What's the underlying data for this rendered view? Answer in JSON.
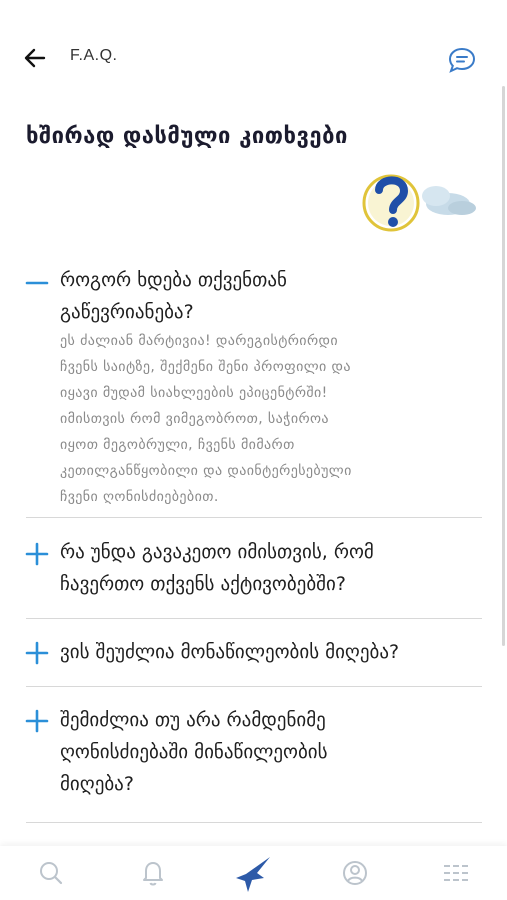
{
  "header": {
    "title": "F.A.Q.",
    "back_icon": "arrow-left-icon",
    "chat_icon": "chat-bubble-icon"
  },
  "page": {
    "title": "ხშირად დასმული კითხვები"
  },
  "faq": [
    {
      "question_lines": [
        "როგორ ხდება თქვენთან",
        "გაწევრიანება?"
      ],
      "expanded": true,
      "answer_lines": [
        "ეს ძალიან მარტივია! დარეგისტრირდი",
        "ჩვენს საიტზე, შექმენი შენი პროფილი და",
        "იყავი მუდამ სიახლეების ეპიცენტრში!",
        "იმისთვის რომ ვიმეგობროთ, საჭიროა",
        "იყოთ მეგობრული, ჩვენს მიმართ",
        "კეთილგანწყობილი და დაინტერესებული",
        "ჩვენი ღონისძიებებით."
      ]
    },
    {
      "question_lines": [
        "რა უნდა გავაკეთო იმისთვის, რომ",
        "ჩავერთო თქვენს აქტივობებში?"
      ],
      "expanded": false
    },
    {
      "question_lines": [
        "ვის შეუძლია მონაწილეობის მიღება?"
      ],
      "expanded": false
    },
    {
      "question_lines": [
        "შემიძლია თუ არა რამდენიმე",
        "ღონისძიებაში მინაწილეობის",
        "მიღება?"
      ],
      "expanded": false
    }
  ],
  "tabbar": {
    "tabs": [
      "search-icon",
      "bell-icon",
      "shooting-star-icon",
      "profile-icon",
      "menu-list-icon"
    ],
    "active": "shooting-star-icon"
  },
  "colors": {
    "accent": "#2b8fd8",
    "icon_inactive": "#bcc4cc",
    "active_tab": "#2d5aa8",
    "answer_text": "#8a8a8a"
  }
}
